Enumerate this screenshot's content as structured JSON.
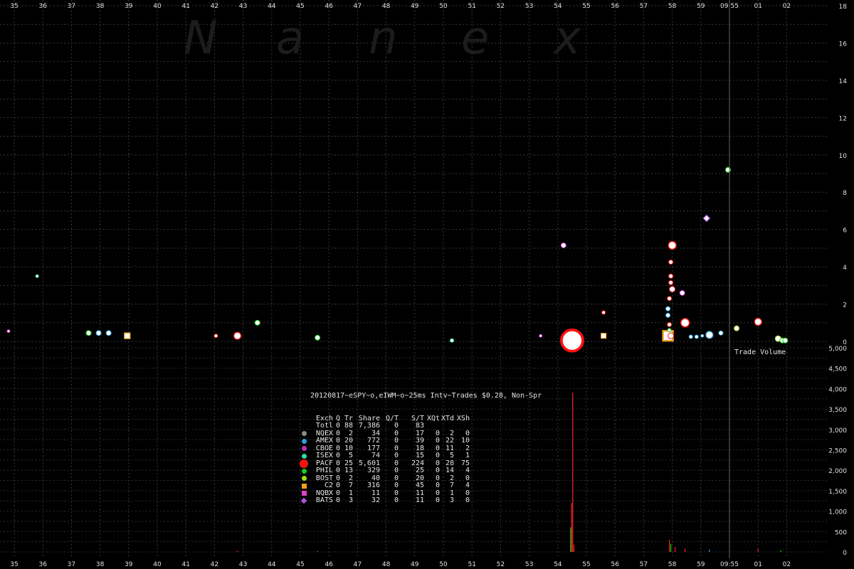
{
  "watermark": [
    "N",
    "a",
    "n",
    "e",
    "x"
  ],
  "chart_data": {
    "type": "scatter",
    "title": "20120817~eSPY~o,eIWM~o~25ms Intv~Trades $0.28, Non-Spr",
    "x_ticks": [
      "35",
      "36",
      "37",
      "38",
      "39",
      "40",
      "41",
      "42",
      "43",
      "44",
      "45",
      "46",
      "47",
      "48",
      "49",
      "50",
      "51",
      "52",
      "53",
      "54",
      "55",
      "56",
      "57",
      "58",
      "59",
      "09:55",
      "01",
      "02"
    ],
    "price_axis": {
      "ylim": [
        0,
        18
      ],
      "ticks": [
        "0",
        "2",
        "4",
        "6",
        "8",
        "10",
        "12",
        "14",
        "16",
        "18"
      ]
    },
    "volume_axis": {
      "label": "Trade Volume",
      "ylim": [
        0,
        5000
      ],
      "ticks": [
        "0",
        "500",
        "1,000",
        "1,500",
        "2,000",
        "2,500",
        "3,000",
        "3,500",
        "4,000",
        "4,500",
        "5,000"
      ]
    },
    "current_time_marker": "09:55",
    "exchanges": [
      {
        "name": "NQEX",
        "color": "#8c8c8c",
        "shape": "circle"
      },
      {
        "name": "AMEX",
        "color": "#2e9fe0",
        "shape": "circle"
      },
      {
        "name": "CBOE",
        "color": "#c030c0",
        "shape": "circle"
      },
      {
        "name": "ISEX",
        "color": "#2ee0a0",
        "shape": "circle"
      },
      {
        "name": "PACF",
        "color": "#ff1010",
        "shape": "circle"
      },
      {
        "name": "PHIL",
        "color": "#10d010",
        "shape": "circle"
      },
      {
        "name": "BOST",
        "color": "#a0e020",
        "shape": "circle"
      },
      {
        "name": "C2",
        "color": "#f0a020",
        "shape": "square"
      },
      {
        "name": "NQBX",
        "color": "#e040c0",
        "shape": "square"
      },
      {
        "name": "BATS",
        "color": "#b050e0",
        "shape": "diamond"
      }
    ],
    "points": [
      {
        "x": 34.8,
        "y": 0.55,
        "ex": "CBOE",
        "r": 2
      },
      {
        "x": 35.8,
        "y": 3.5,
        "ex": "ISEX",
        "r": 2
      },
      {
        "x": 37.6,
        "y": 0.45,
        "ex": "PHIL",
        "r": 3.5
      },
      {
        "x": 37.95,
        "y": 0.45,
        "ex": "AMEX",
        "r": 3.5
      },
      {
        "x": 38.3,
        "y": 0.45,
        "ex": "AMEX",
        "r": 3.5
      },
      {
        "x": 38.95,
        "y": 0.3,
        "ex": "C2",
        "r": 4
      },
      {
        "x": 42.05,
        "y": 0.3,
        "ex": "PACF",
        "r": 2.5
      },
      {
        "x": 42.8,
        "y": 0.3,
        "ex": "PACF",
        "r": 5
      },
      {
        "x": 43.5,
        "y": 1.0,
        "ex": "PHIL",
        "r": 3.5
      },
      {
        "x": 45.6,
        "y": 0.2,
        "ex": "PHIL",
        "r": 3.5
      },
      {
        "x": 50.3,
        "y": 0.05,
        "ex": "ISEX",
        "r": 2.5
      },
      {
        "x": 53.4,
        "y": 0.3,
        "ex": "CBOE",
        "r": 2
      },
      {
        "x": 54.2,
        "y": 5.15,
        "ex": "CBOE",
        "r": 3.5
      },
      {
        "x": 54.5,
        "y": 0.05,
        "ex": "PACF",
        "r": 15
      },
      {
        "x": 55.6,
        "y": 0.3,
        "ex": "C2",
        "r": 3.5
      },
      {
        "x": 55.6,
        "y": 1.55,
        "ex": "PACF",
        "r": 2.5
      },
      {
        "x": 57.85,
        "y": 0.3,
        "ex": "C2",
        "r": 7
      },
      {
        "x": 57.95,
        "y": 0.3,
        "ex": "PACF",
        "r": 4
      },
      {
        "x": 57.9,
        "y": 0.6,
        "ex": "PHIL",
        "r": 2.5
      },
      {
        "x": 57.9,
        "y": 0.9,
        "ex": "PACF",
        "r": 3
      },
      {
        "x": 57.85,
        "y": 1.4,
        "ex": "AMEX",
        "r": 3
      },
      {
        "x": 57.85,
        "y": 1.75,
        "ex": "AMEX",
        "r": 3
      },
      {
        "x": 57.9,
        "y": 2.3,
        "ex": "PACF",
        "r": 3
      },
      {
        "x": 58.0,
        "y": 2.8,
        "ex": "PACF",
        "r": 4
      },
      {
        "x": 58.35,
        "y": 2.6,
        "ex": "CBOE",
        "r": 3.5
      },
      {
        "x": 57.95,
        "y": 3.15,
        "ex": "PACF",
        "r": 3
      },
      {
        "x": 57.95,
        "y": 3.5,
        "ex": "PACF",
        "r": 3
      },
      {
        "x": 57.95,
        "y": 4.25,
        "ex": "PACF",
        "r": 3
      },
      {
        "x": 58.0,
        "y": 5.15,
        "ex": "PACF",
        "r": 5.5
      },
      {
        "x": 58.45,
        "y": 1.0,
        "ex": "PACF",
        "r": 6
      },
      {
        "x": 58.65,
        "y": 0.25,
        "ex": "AMEX",
        "r": 2.5
      },
      {
        "x": 58.85,
        "y": 0.25,
        "ex": "AMEX",
        "r": 2.5
      },
      {
        "x": 59.05,
        "y": 0.3,
        "ex": "AMEX",
        "r": 2
      },
      {
        "x": 59.3,
        "y": 0.35,
        "ex": "AMEX",
        "r": 5
      },
      {
        "x": 59.7,
        "y": 0.45,
        "ex": "AMEX",
        "r": 3
      },
      {
        "x": 59.2,
        "y": 6.6,
        "ex": "BATS",
        "r": 4.5
      },
      {
        "x": 59.95,
        "y": 9.2,
        "ex": "PHIL",
        "r": 3.5
      },
      {
        "x": 60.25,
        "y": 0.7,
        "ex": "BOST",
        "r": 3.5
      },
      {
        "x": 61.0,
        "y": 1.05,
        "ex": "PACF",
        "r": 5
      },
      {
        "x": 61.7,
        "y": 0.15,
        "ex": "BOST",
        "r": 4
      },
      {
        "x": 61.85,
        "y": 0.05,
        "ex": "PHIL",
        "r": 3.5
      },
      {
        "x": 61.95,
        "y": 0.05,
        "ex": "PHIL",
        "r": 3.5
      }
    ],
    "volume_bars": [
      {
        "x": 54.48,
        "v": 1200,
        "color": "#ff2020"
      },
      {
        "x": 54.52,
        "v": 3900,
        "color": "#ff2020"
      },
      {
        "x": 54.45,
        "v": 600,
        "color": "#10d010"
      },
      {
        "x": 54.56,
        "v": 180,
        "color": "#ff2020"
      },
      {
        "x": 57.9,
        "v": 300,
        "color": "#ff2020"
      },
      {
        "x": 57.95,
        "v": 200,
        "color": "#10d010"
      },
      {
        "x": 58.1,
        "v": 120,
        "color": "#ff2020"
      },
      {
        "x": 58.45,
        "v": 80,
        "color": "#ff2020"
      },
      {
        "x": 59.3,
        "v": 60,
        "color": "#2e9fe0"
      },
      {
        "x": 61.0,
        "v": 70,
        "color": "#ff2020"
      },
      {
        "x": 61.8,
        "v": 40,
        "color": "#10d010"
      },
      {
        "x": 42.8,
        "v": 30,
        "color": "#ff2020"
      },
      {
        "x": 45.6,
        "v": 20,
        "color": "#10d010"
      }
    ],
    "table": {
      "headers": [
        "Exch",
        "Q",
        "Tr",
        "Share",
        "Q/T",
        "S/T",
        "XQt",
        "XTd",
        "XSh"
      ],
      "rows": [
        [
          "Totl",
          "0",
          "88",
          "7,386",
          "0",
          "83",
          "",
          "",
          ""
        ],
        [
          "NQEX",
          "0",
          "2",
          "34",
          "0",
          "17",
          "0",
          "2",
          "0"
        ],
        [
          "AMEX",
          "0",
          "20",
          "772",
          "0",
          "39",
          "0",
          "22",
          "10"
        ],
        [
          "CBOE",
          "0",
          "10",
          "177",
          "0",
          "18",
          "0",
          "11",
          "2"
        ],
        [
          "ISEX",
          "0",
          "5",
          "74",
          "0",
          "15",
          "0",
          "5",
          "1"
        ],
        [
          "PACF",
          "0",
          "25",
          "5,601",
          "0",
          "224",
          "0",
          "28",
          "75"
        ],
        [
          "PHIL",
          "0",
          "13",
          "329",
          "0",
          "25",
          "0",
          "14",
          "4"
        ],
        [
          "BOST",
          "0",
          "2",
          "40",
          "0",
          "20",
          "0",
          "2",
          "0"
        ],
        [
          "C2",
          "0",
          "7",
          "316",
          "0",
          "45",
          "0",
          "7",
          "4"
        ],
        [
          "NQBX",
          "0",
          "1",
          "11",
          "0",
          "11",
          "0",
          "1",
          "0"
        ],
        [
          "BATS",
          "0",
          "3",
          "32",
          "0",
          "11",
          "0",
          "3",
          "0"
        ]
      ]
    }
  }
}
